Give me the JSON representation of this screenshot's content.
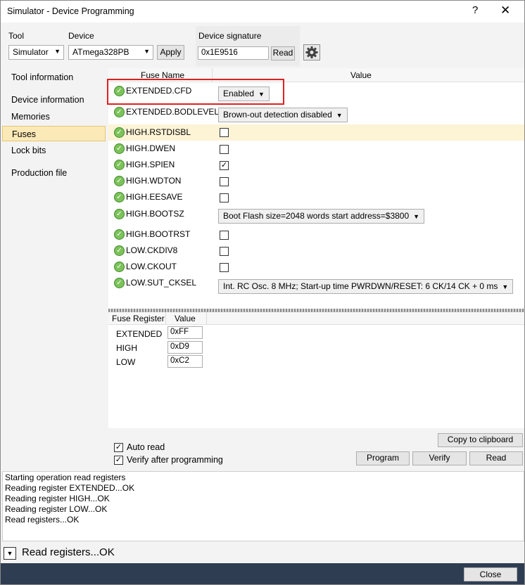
{
  "window": {
    "title": "Simulator - Device Programming",
    "help_glyph": "?",
    "close_glyph": "✕"
  },
  "tool": {
    "tool_label": "Tool",
    "device_label": "Device",
    "signature_label": "Device signature",
    "tool_value": "Simulator",
    "device_value": "ATmega328PB",
    "apply_label": "Apply",
    "signature_value": "0x1E9516",
    "read_label": "Read",
    "gear_icon": "gear-icon"
  },
  "sidebar": {
    "items": [
      {
        "label": "Tool information"
      },
      {
        "label": "Device information"
      },
      {
        "label": "Memories"
      },
      {
        "label": "Fuses"
      },
      {
        "label": "Lock bits"
      },
      {
        "label": "Production file"
      }
    ],
    "selected": "Fuses"
  },
  "fuses": {
    "header_name": "Fuse Name",
    "header_value": "Value",
    "rows": [
      {
        "name": "EXTENDED.CFD",
        "type": "select",
        "value": "Enabled"
      },
      {
        "name": "EXTENDED.BODLEVEL",
        "type": "select",
        "value": "Brown-out detection disabled"
      },
      {
        "name": "HIGH.RSTDISBL",
        "type": "check",
        "checked": false
      },
      {
        "name": "HIGH.DWEN",
        "type": "check",
        "checked": false
      },
      {
        "name": "HIGH.SPIEN",
        "type": "check",
        "checked": true
      },
      {
        "name": "HIGH.WDTON",
        "type": "check",
        "checked": false
      },
      {
        "name": "HIGH.EESAVE",
        "type": "check",
        "checked": false
      },
      {
        "name": "HIGH.BOOTSZ",
        "type": "select",
        "value": "Boot Flash size=2048 words start address=$3800"
      },
      {
        "name": "HIGH.BOOTRST",
        "type": "check",
        "checked": false
      },
      {
        "name": "LOW.CKDIV8",
        "type": "check",
        "checked": false
      },
      {
        "name": "LOW.CKOUT",
        "type": "check",
        "checked": false
      },
      {
        "name": "LOW.SUT_CKSEL",
        "type": "select",
        "value": "Int. RC Osc. 8 MHz; Start-up time PWRDWN/RESET: 6 CK/14 CK + 0 ms"
      }
    ],
    "check_glyph": "✓"
  },
  "registers": {
    "header_register": "Fuse Register",
    "header_value": "Value",
    "rows": [
      {
        "name": "EXTENDED",
        "value": "0xFF"
      },
      {
        "name": "HIGH",
        "value": "0xD9"
      },
      {
        "name": "LOW",
        "value": "0xC2"
      }
    ]
  },
  "controls": {
    "auto_read": "Auto read",
    "verify_after": "Verify after programming",
    "copy_label": "Copy to clipboard",
    "program_label": "Program",
    "verify_label": "Verify",
    "read_label": "Read"
  },
  "log": {
    "lines": [
      "Starting operation read registers",
      "Reading register EXTENDED...OK",
      "Reading register HIGH...OK",
      "Reading register LOW...OK",
      "Read registers...OK"
    ]
  },
  "status": {
    "text": "Read registers...OK",
    "expander_glyph": "▼"
  },
  "footer": {
    "close_label": "Close"
  }
}
